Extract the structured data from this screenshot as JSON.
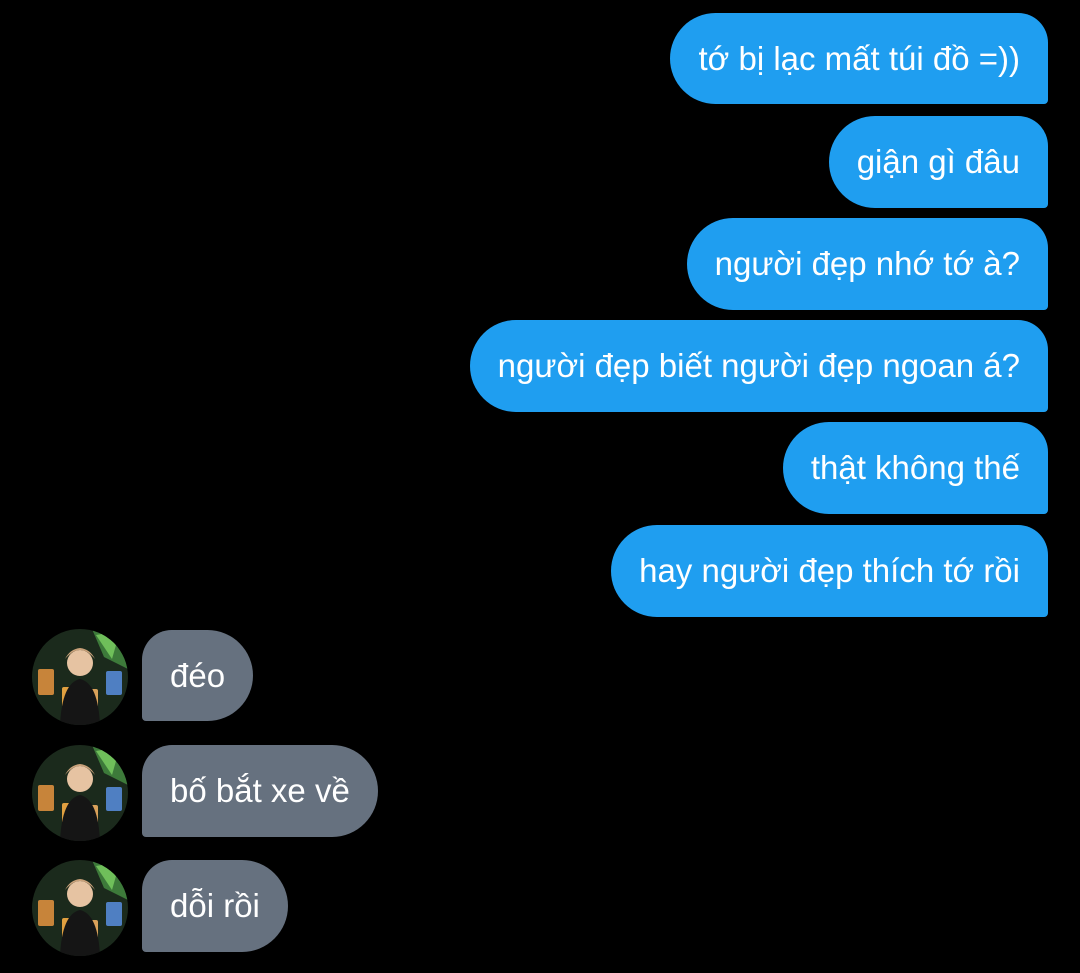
{
  "colors": {
    "background": "#000000",
    "outgoing_bubble": "#1f9ef0",
    "incoming_bubble": "#66717f",
    "text": "#ffffff"
  },
  "messages": {
    "outgoing": [
      "tớ bị lạc mất túi đồ =))",
      "giận gì đâu",
      "người đẹp nhớ tớ à?",
      "người đẹp biết người đẹp ngoan á?",
      "thật không thế",
      "hay người đẹp thích tớ rồi"
    ],
    "incoming": [
      "đéo",
      "bố bắt xe về",
      "dỗi rồi"
    ]
  },
  "icons": {
    "avatar": "contact-avatar-photo"
  }
}
